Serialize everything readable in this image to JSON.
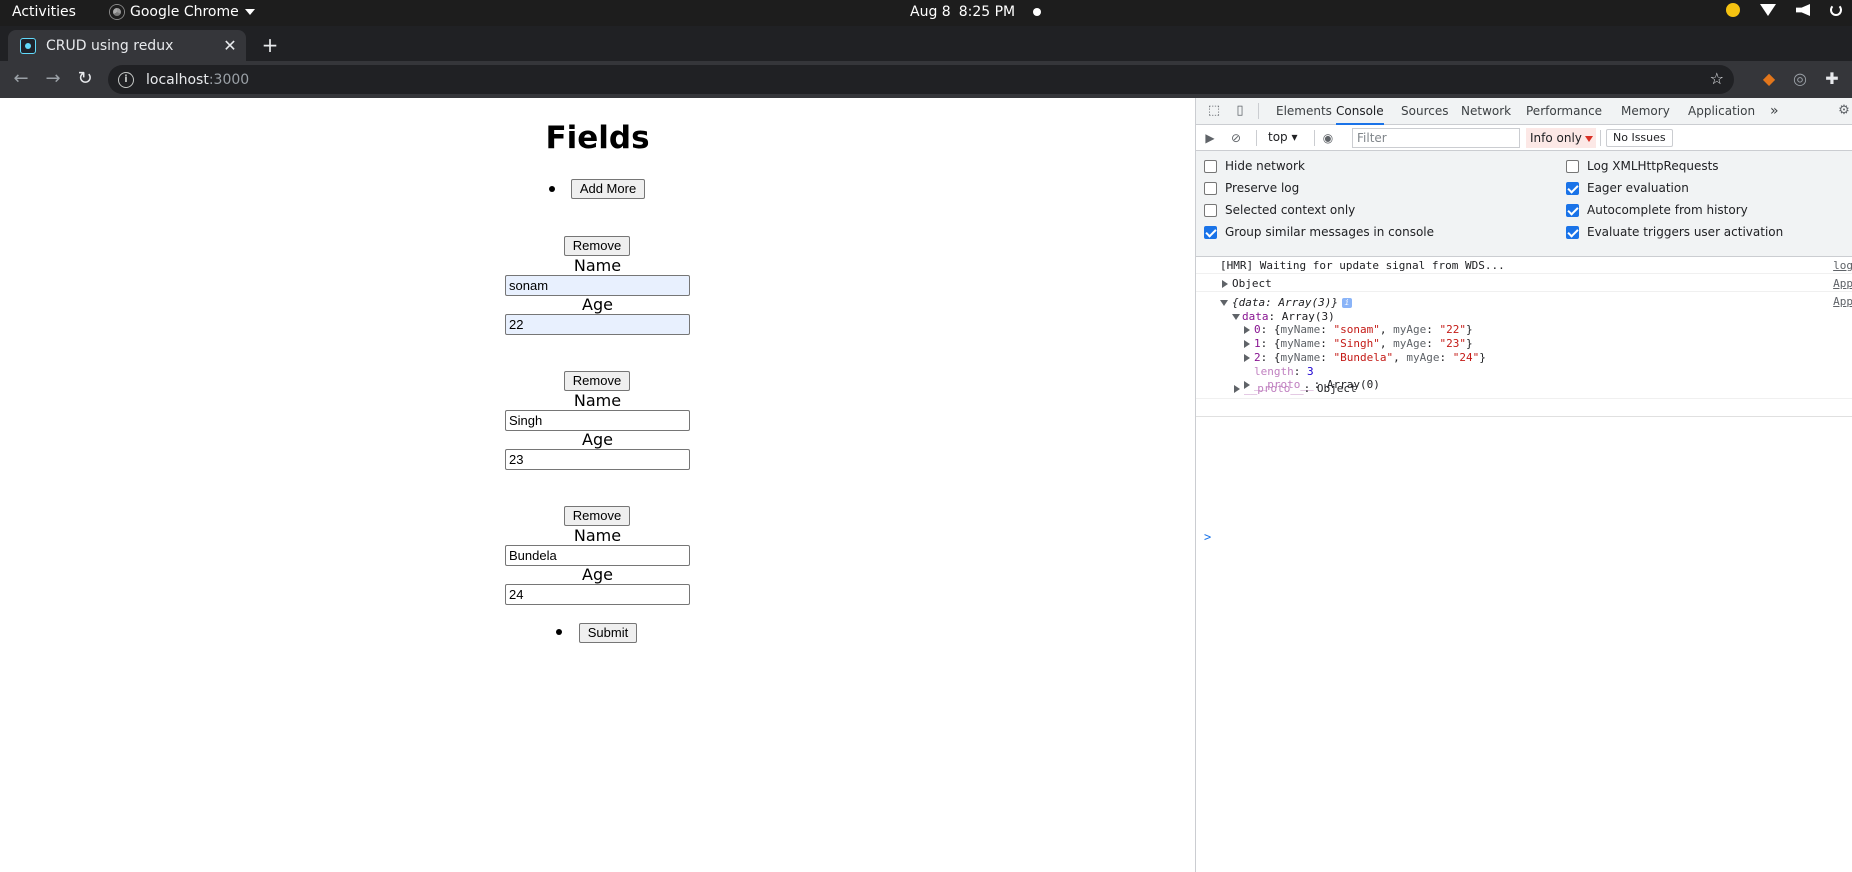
{
  "os": {
    "activities": "Activities",
    "app_name": "Google Chrome",
    "date": "Aug 8",
    "time": "8:25 PM"
  },
  "browser": {
    "tab_title": "CRUD using redux",
    "new_tab": "+",
    "url_host": "localhost",
    "url_port": ":3000"
  },
  "page": {
    "heading": "Fields",
    "add_more": "Add More",
    "remove": "Remove",
    "name_label": "Name",
    "age_label": "Age",
    "submit": "Submit",
    "entries": [
      {
        "name": "sonam",
        "age": "22"
      },
      {
        "name": "Singh",
        "age": "23"
      },
      {
        "name": "Bundela",
        "age": "24"
      }
    ]
  },
  "devtools": {
    "tabs": [
      "Elements",
      "Console",
      "Sources",
      "Network",
      "Performance",
      "Memory",
      "Application"
    ],
    "active_tab": "Console",
    "more_tabs": "»",
    "context": "top",
    "filter_placeholder": "Filter",
    "levels": "Info only",
    "issues": "No Issues",
    "settings": {
      "left": [
        {
          "label": "Hide network",
          "checked": false
        },
        {
          "label": "Preserve log",
          "checked": false
        },
        {
          "label": "Selected context only",
          "checked": false
        },
        {
          "label": "Group similar messages in console",
          "checked": true
        }
      ],
      "right": [
        {
          "label": "Log XMLHttpRequests",
          "checked": false
        },
        {
          "label": "Eager evaluation",
          "checked": true
        },
        {
          "label": "Autocomplete from history",
          "checked": true
        },
        {
          "label": "Evaluate triggers user activation",
          "checked": true
        }
      ]
    },
    "console": {
      "hmr_msg": "[HMR] Waiting for update signal from WDS...",
      "hmr_src": "log",
      "object_msg": "Object",
      "object_src": "App",
      "data_src": "App",
      "data_summary_key": "{data: Array(3)}",
      "data_key": "data",
      "data_type": "Array(3)",
      "items": [
        {
          "index": "0",
          "myName": "\"sonam\"",
          "myAge": "\"22\""
        },
        {
          "index": "1",
          "myName": "\"Singh\"",
          "myAge": "\"23\""
        },
        {
          "index": "2",
          "myName": "\"Bundela\"",
          "myAge": "\"24\""
        }
      ],
      "length_key": "length",
      "length_val": "3",
      "proto_key": "__proto__",
      "proto_array": "Array(0)",
      "proto_object": "Object",
      "prompt": ">"
    }
  }
}
